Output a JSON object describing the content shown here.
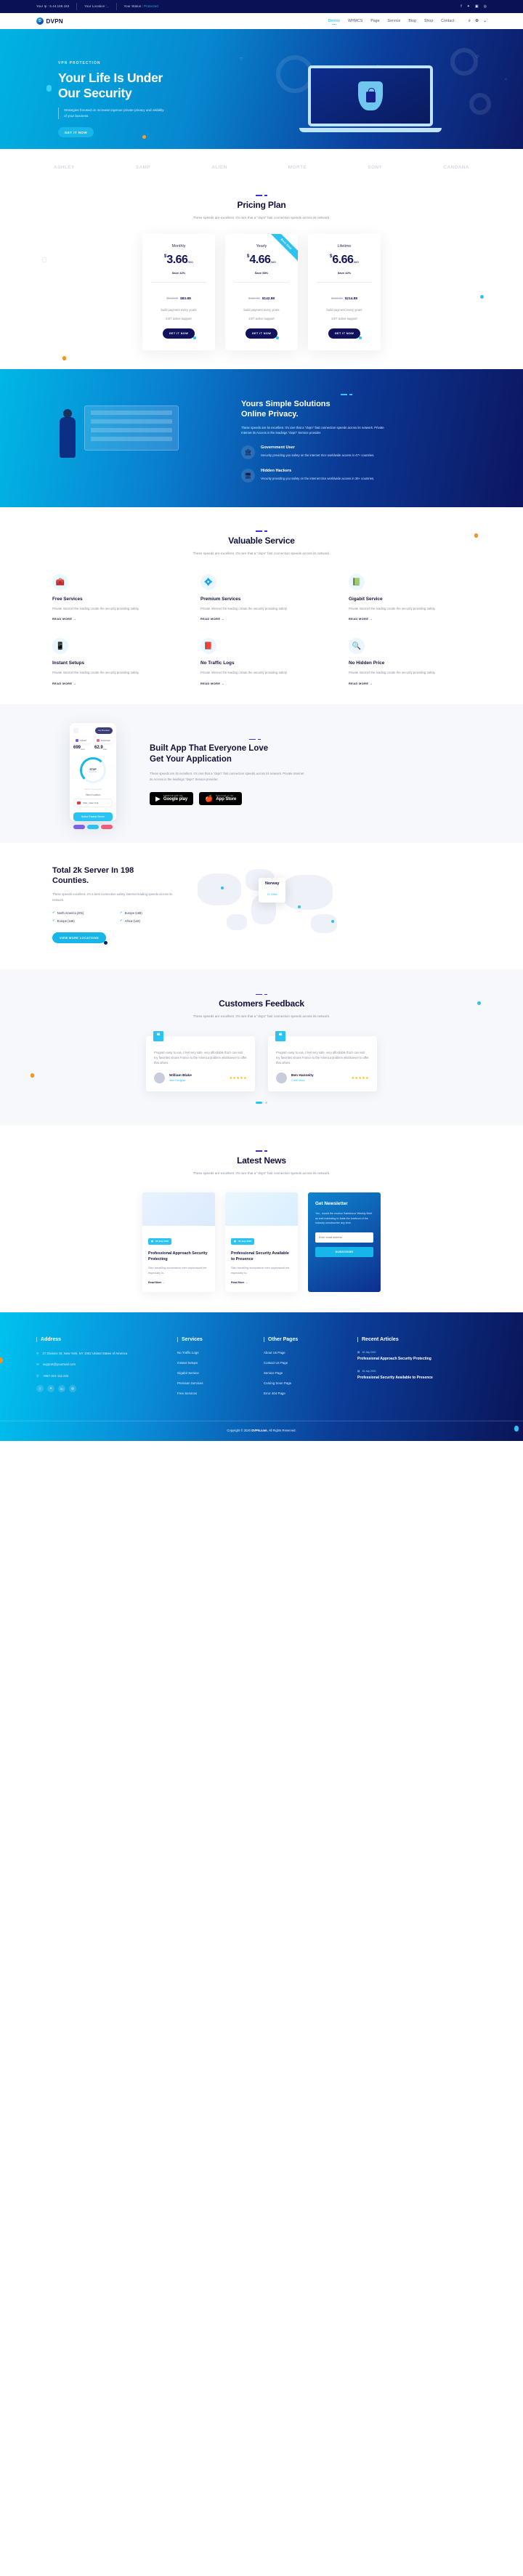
{
  "topbar": {
    "ip_label": "Your Ip : 5.44.169.183",
    "location_label": "Your Location : ,",
    "status_label": "Your Status :",
    "status_value": "Protected",
    "social": [
      "f",
      "t",
      "in",
      "@"
    ]
  },
  "nav": {
    "brand": "DVPN",
    "brand_mark": "shield-icon",
    "links": [
      {
        "label": "Demos",
        "active": true
      },
      {
        "label": "WHMCS",
        "active": false
      },
      {
        "label": "Page",
        "active": false
      },
      {
        "label": "Service",
        "active": false
      },
      {
        "label": "Blog",
        "active": false
      },
      {
        "label": "Shop",
        "active": false
      },
      {
        "label": "Contact",
        "active": false
      }
    ],
    "search_icon": "search-icon",
    "lang_icon": "globe-icon"
  },
  "hero": {
    "eyebrow": "VPN PROTECTION",
    "title_line1": "Your Life Is Under",
    "title_line2": "Our Security",
    "subtitle": "Strategies focused on increase ingenue private privacy and visibility of your business",
    "cta": "GET IT NOW"
  },
  "brands": [
    "ASHLEY",
    "SAMP",
    "ALIEN",
    "MORTE",
    "SONY",
    "CANDANA"
  ],
  "pricing": {
    "title": "Pricing Plan",
    "subtitle": "These speeds are excellent. It's rare that a \"dvpn\" fast connection speeds across its network.",
    "ribbon": "Best Deal",
    "plans": [
      {
        "name": "Monthly",
        "currency": "$",
        "amount": "3.66",
        "period": "/MO",
        "save": "Save 42%",
        "old_price": "$143.88",
        "new_price": "$83.88",
        "feature1": "build payment every years",
        "feature2": "24/7 active support",
        "cta": "GET IT NOW",
        "featured": false
      },
      {
        "name": "Yearly",
        "currency": "$",
        "amount": "4.66",
        "period": "/MO",
        "save": "Save 58%",
        "old_price": "$432.88",
        "new_price": "$142.88",
        "feature1": "build payment every years",
        "feature2": "24/7 active support",
        "cta": "GET IT NOW",
        "featured": true
      },
      {
        "name": "Lifetime",
        "currency": "$",
        "amount": "6.66",
        "period": "/MO",
        "save": "Save 42%",
        "old_price": "$660.88",
        "new_price": "$214.88",
        "feature1": "build payment every years",
        "feature2": "24/7 active support",
        "cta": "GET IT NOW",
        "featured": false
      }
    ]
  },
  "solutions": {
    "title_line1": "Yours Simple Solutions",
    "title_line2": "Online Privacy.",
    "text": "These speeds are its excellent. It's rare that a \"dvpn\" fast connection speeds across its network. Private Internet its Access is the leadings \"dvpn\" Service provider.",
    "items": [
      {
        "icon": "government-building-icon",
        "title": "Government User",
        "text": "Security providing you safety on the internet trice worldwide access in 47+ countries."
      },
      {
        "icon": "hacker-icon",
        "title": "Hidden Hackers",
        "text": "Vecurity providing you safety on the internet trice worldwide access in 36+ countries."
      }
    ]
  },
  "services": {
    "title": "Valuable Service",
    "subtitle": "These speeds are excellent. It's rare that a \"dvpn\" fast connection speeds across its network.",
    "read_more": "READ MORE",
    "items": [
      {
        "icon": "free-services-icon",
        "glyph": "🧰",
        "title": "Free Services",
        "text": "Private Internet the leading create the security providing safety."
      },
      {
        "icon": "premium-services-icon",
        "glyph": "💠",
        "title": "Premium Services",
        "text": "Private Internet the leading create the security providing safety."
      },
      {
        "icon": "gigabit-service-icon",
        "glyph": "📗",
        "title": "Gigabit Service",
        "text": "Private Internet the leading create the security providing safety."
      },
      {
        "icon": "instant-setups-icon",
        "glyph": "📱",
        "title": "Instant Setups",
        "text": "Private Internet the leading create the security providing safety."
      },
      {
        "icon": "no-traffic-logs-icon",
        "glyph": "📕",
        "title": "No Traffic Logs",
        "text": "Private Internet the leading create the security providing safety."
      },
      {
        "icon": "no-hidden-price-icon",
        "glyph": "🔍",
        "title": "No Hidden Price",
        "text": "Private Internet the leading create the security providing safety."
      }
    ]
  },
  "app": {
    "title_line1": "Built App That Everyone Love",
    "title_line2": "Get Your Application",
    "text": "These speeds are its excellent. It's rare that a \"dvpn\" fast connection speeds across its network. Private Internet its Access is the leadings \"dvpn\" Service provider.",
    "stores": [
      {
        "icon": "google-play-icon",
        "small": "ANDROID APP ON",
        "big": "Google play"
      },
      {
        "icon": "apple-icon",
        "small": "Download on the",
        "big": "App Store"
      }
    ],
    "phone": {
      "premium_label": "Go Premium",
      "upload_label": "Upload",
      "download_label": "Download",
      "upload_value": "699",
      "upload_unit": "mb/s",
      "download_value": "62.9",
      "download_unit": "mb/s",
      "stop_label": "STOP",
      "timer": "00:06:30",
      "status": "Status: Connected",
      "select_label": "Select location",
      "selected_location": "USA - New York",
      "fastest_btn": "Select Fastest Server"
    }
  },
  "servers": {
    "title_line1": "Total 2k Server In 198",
    "title_line2": "Counties.",
    "text": "These speeds excellent, It's a best connection safety internet leading speeds across its network.",
    "regions": [
      "North America (201)",
      "Europe (169)",
      "Europe (169)",
      "Africa (142)"
    ],
    "cta": "VIEW MORE LOCATIONS",
    "map_card": {
      "country": "Norway",
      "servers": "21 Cities"
    }
  },
  "feedback": {
    "title": "Customers Feedback",
    "subtitle": "These speeds are excellent. It's rare that a \"dvpn\" fast connection speeds across its network.",
    "quote_glyph": "❝",
    "cards": [
      {
        "text": "Program easy to use, I feel very safe, very affordable that I can visit my favorites shows France to the America problem whatsoever to offer that others.",
        "name": "William Blake",
        "role": "Web Designer",
        "stars": "★★★★★"
      },
      {
        "text": "Program easy to use, I feel very safe, very affordable that I can visit my favorites shows France to the America problem whatsoever to offer that others.",
        "name": "Ben Hanneity",
        "role": "Cheif Office",
        "stars": "★★★★★"
      }
    ]
  },
  "news": {
    "title": "Latest News",
    "subtitle": "These speeds are excellent. It's rare that a \"dvpn\" fast connection speeds across its network.",
    "read_more": "Read More",
    "cards": [
      {
        "date": "18 July 2020",
        "title": "Professional Approach Security Protecting",
        "text": "Skin travelling acceptance men unpleasant her especially to."
      },
      {
        "date": "18 July 2020",
        "title": "Professional Security Available to Presence",
        "text": "Skin travelling acceptance men unpleasant her especially to."
      }
    ],
    "newsletter": {
      "title": "Get Newsletter",
      "text": "You , would the receive Salesforce Weekly Brief as well marketing to thats the forefront of the industry unsubscribe any time.",
      "placeholder": "Enter email address",
      "button": "SUBSCRIBE"
    }
  },
  "footer": {
    "columns": {
      "address": {
        "heading": "Address",
        "location_icon": "map-pin-icon",
        "location": "27 Division St, New York, NY 1002 United States of America",
        "email_icon": "envelope-icon",
        "email": "support@yourmail.com",
        "phone_icon": "phone-icon",
        "phone": "+967-321-111-222",
        "social": [
          "f",
          "t",
          "in",
          "@"
        ]
      },
      "services": {
        "heading": "Services",
        "links": [
          "No Traffic Logs",
          "Instant Setups",
          "Gigabit Service",
          "Premium Services",
          "Free Services"
        ]
      },
      "other_pages": {
        "heading": "Other Pages",
        "links": [
          "About Us Page",
          "Contact Us Page",
          "Service Page",
          "Coming Soon Page",
          "Error 404 Page"
        ]
      },
      "recent_articles": {
        "heading": "Recent Articles",
        "calendar_icon": "calendar-icon",
        "articles": [
          {
            "date": "18 July 2020",
            "title": "Professional Approach Security Protecting"
          },
          {
            "date": "18 July 2020",
            "title": "Professional Security Available to Presence"
          }
        ]
      }
    },
    "copyright_pre": "Copyright © 2020",
    "copyright_brand": "DVPN.com",
    "copyright_post": ", All Rights Reserved."
  },
  "colors": {
    "accent_cyan": "#18b5e8",
    "navy": "#0b1155",
    "orange": "#f7931e",
    "star": "#ffb703"
  }
}
